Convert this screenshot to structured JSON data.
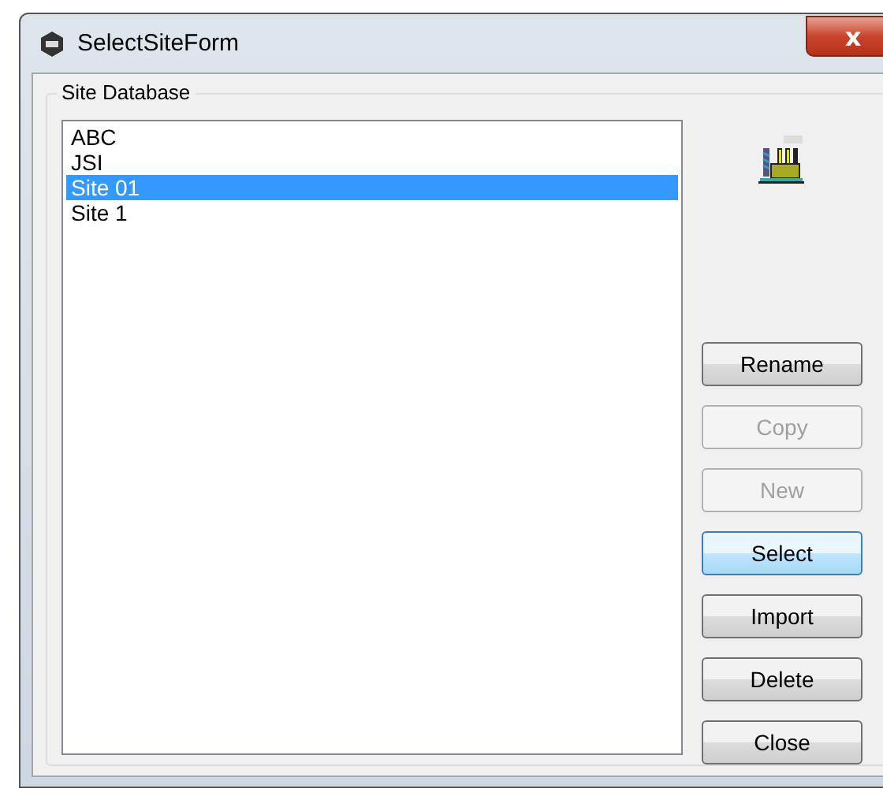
{
  "window": {
    "title": "SelectSiteForm",
    "close_label": "x"
  },
  "group": {
    "title": "Site Database"
  },
  "sites": [
    {
      "name": "ABC",
      "selected": false
    },
    {
      "name": "JSI",
      "selected": false
    },
    {
      "name": "Site 01",
      "selected": true
    },
    {
      "name": "Site 1",
      "selected": false
    }
  ],
  "buttons": [
    {
      "label": "Rename",
      "disabled": false,
      "focused": false
    },
    {
      "label": "Copy",
      "disabled": true,
      "focused": false
    },
    {
      "label": "New",
      "disabled": true,
      "focused": false
    },
    {
      "label": "Select",
      "disabled": false,
      "focused": true
    },
    {
      "label": "Import",
      "disabled": false,
      "focused": false
    },
    {
      "label": "Delete",
      "disabled": false,
      "focused": false
    },
    {
      "label": "Close",
      "disabled": false,
      "focused": false
    }
  ]
}
